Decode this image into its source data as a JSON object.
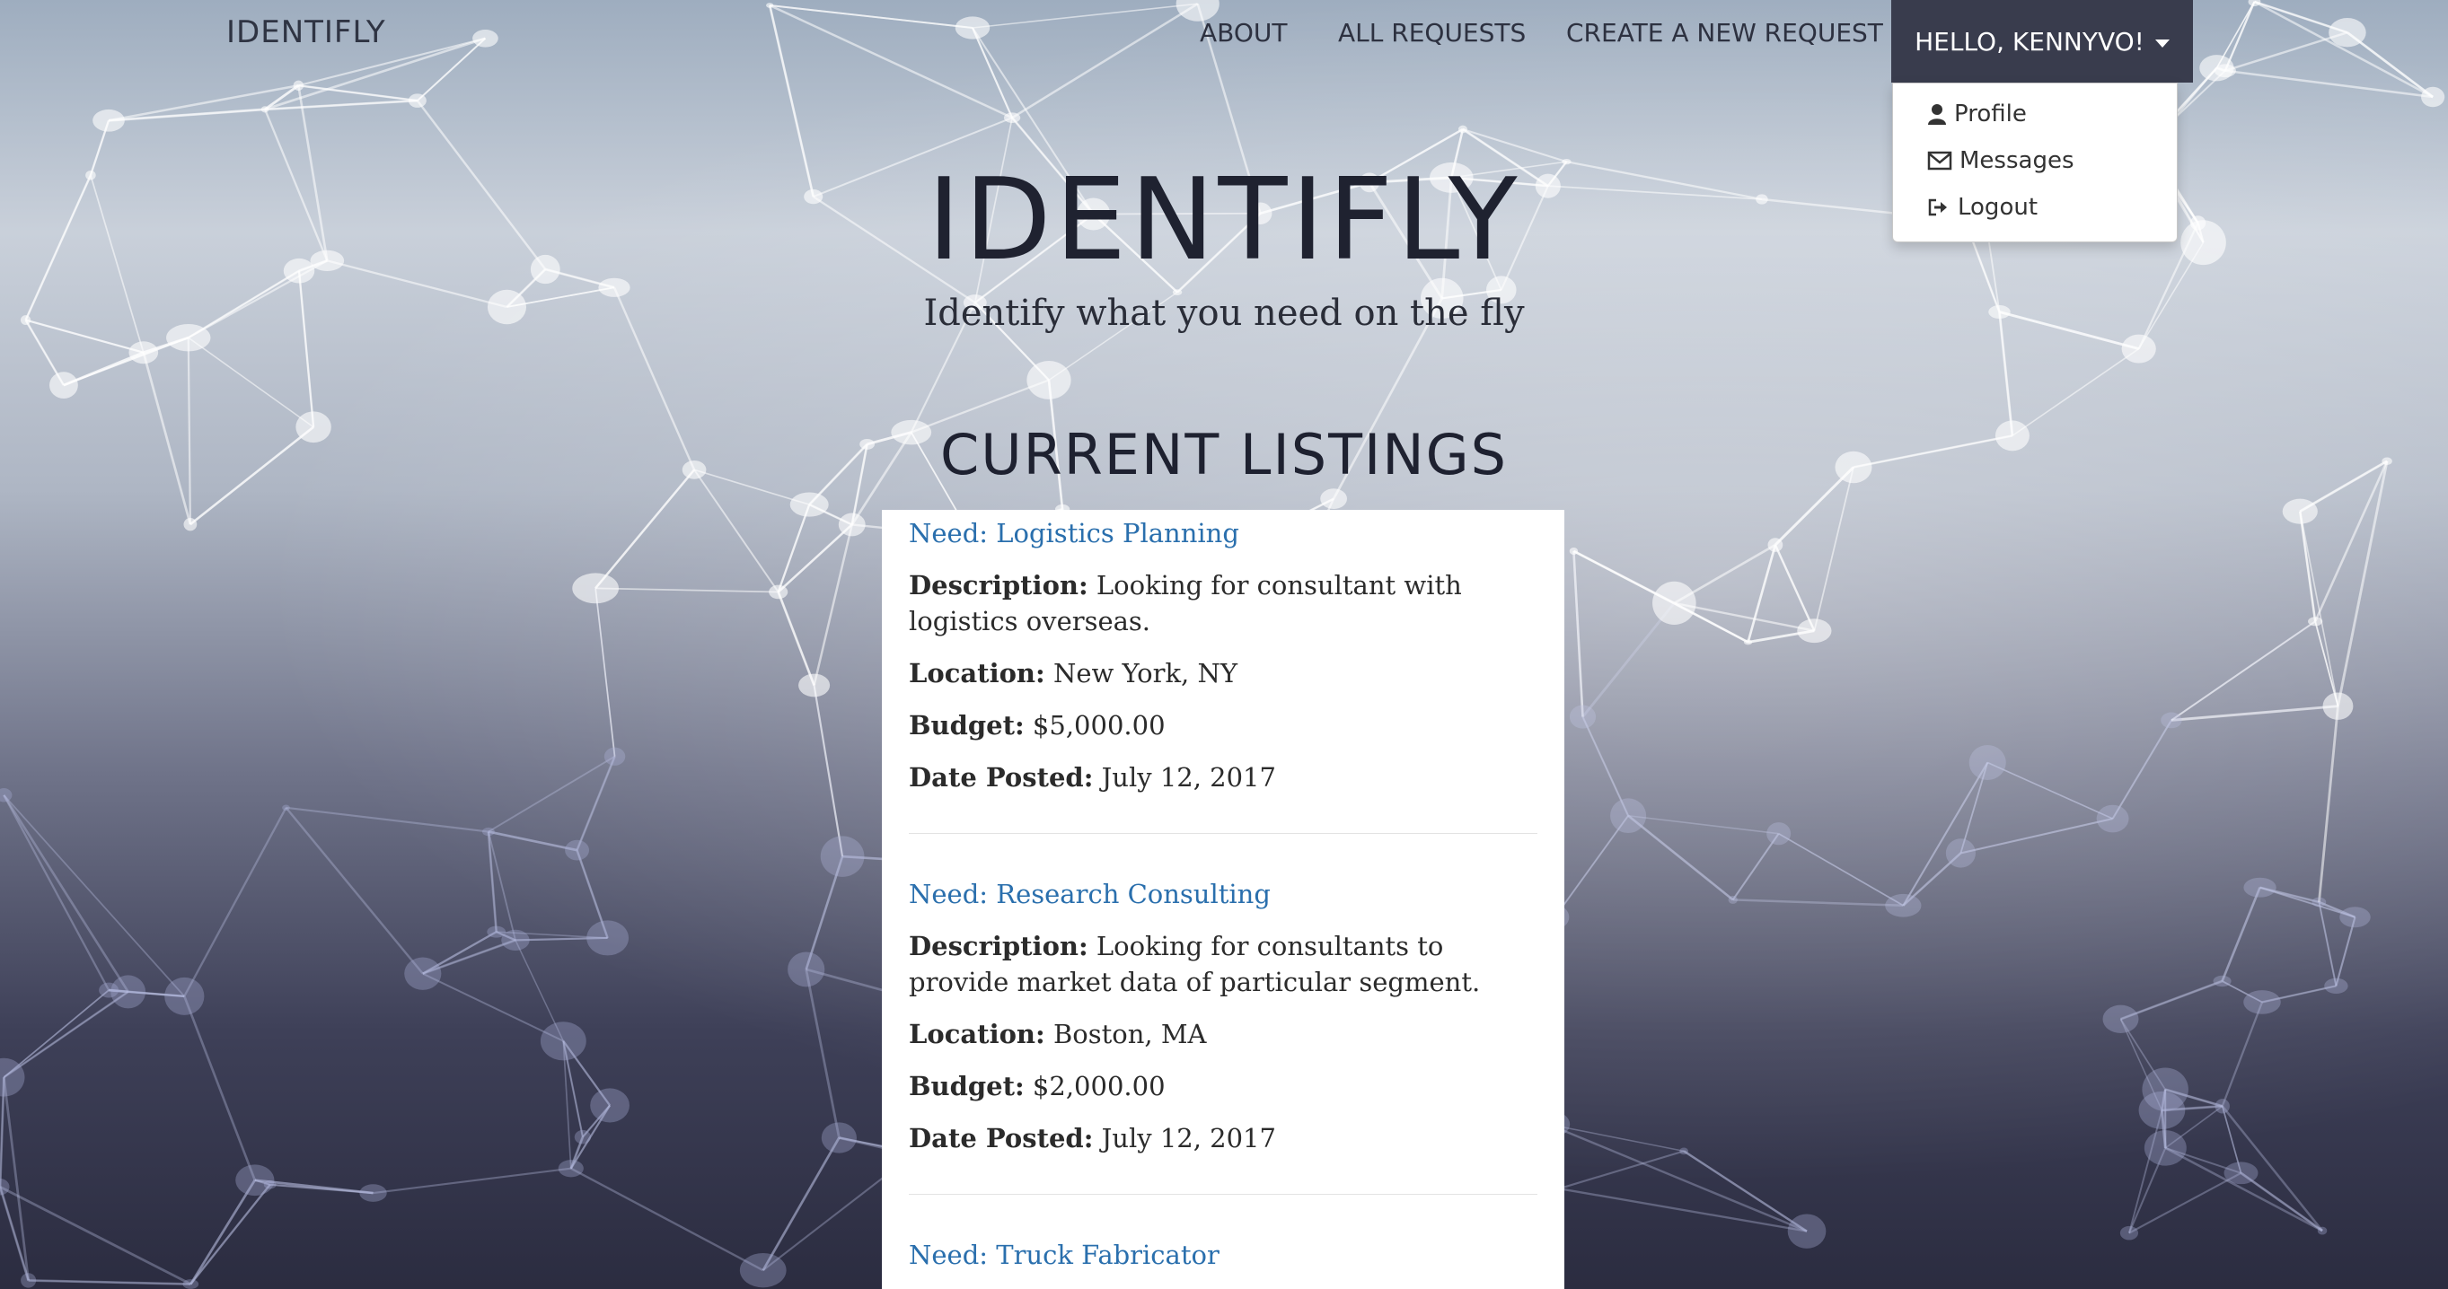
{
  "navbar": {
    "brand": "IDENTIFLY",
    "about": "ABOUT",
    "all_requests": "ALL REQUESTS",
    "create_request": "CREATE A NEW REQUEST",
    "user_greeting": "HELLO, KENNYVO!"
  },
  "user_menu": {
    "items": [
      {
        "label": "Profile",
        "icon": "user-icon"
      },
      {
        "label": "Messages",
        "icon": "envelope-icon"
      },
      {
        "label": "Logout",
        "icon": "sign-out-icon"
      }
    ]
  },
  "hero": {
    "title": "IDENTIFLY",
    "subtitle": "Identify what you need on the fly"
  },
  "listings": {
    "heading": "CURRENT LISTINGS",
    "labels": {
      "description": "Description:",
      "location": "Location:",
      "budget": "Budget:",
      "date_posted": "Date Posted:"
    },
    "items": [
      {
        "need": "Need: Logistics Planning",
        "description": "Looking for consultant with logistics overseas.",
        "location": "New York, NY",
        "budget": "$5,000.00",
        "date_posted": "July 12, 2017"
      },
      {
        "need": "Need: Research Consulting",
        "description": "Looking for consultants to provide market data of particular segment.",
        "location": "Boston, MA",
        "budget": "$2,000.00",
        "date_posted": "July 12, 2017"
      },
      {
        "need": "Need: Truck Fabricator"
      }
    ]
  },
  "colors": {
    "link": "#2a6fad",
    "nav_active_bg": "#393c4d",
    "heading_text": "#1f2230"
  }
}
